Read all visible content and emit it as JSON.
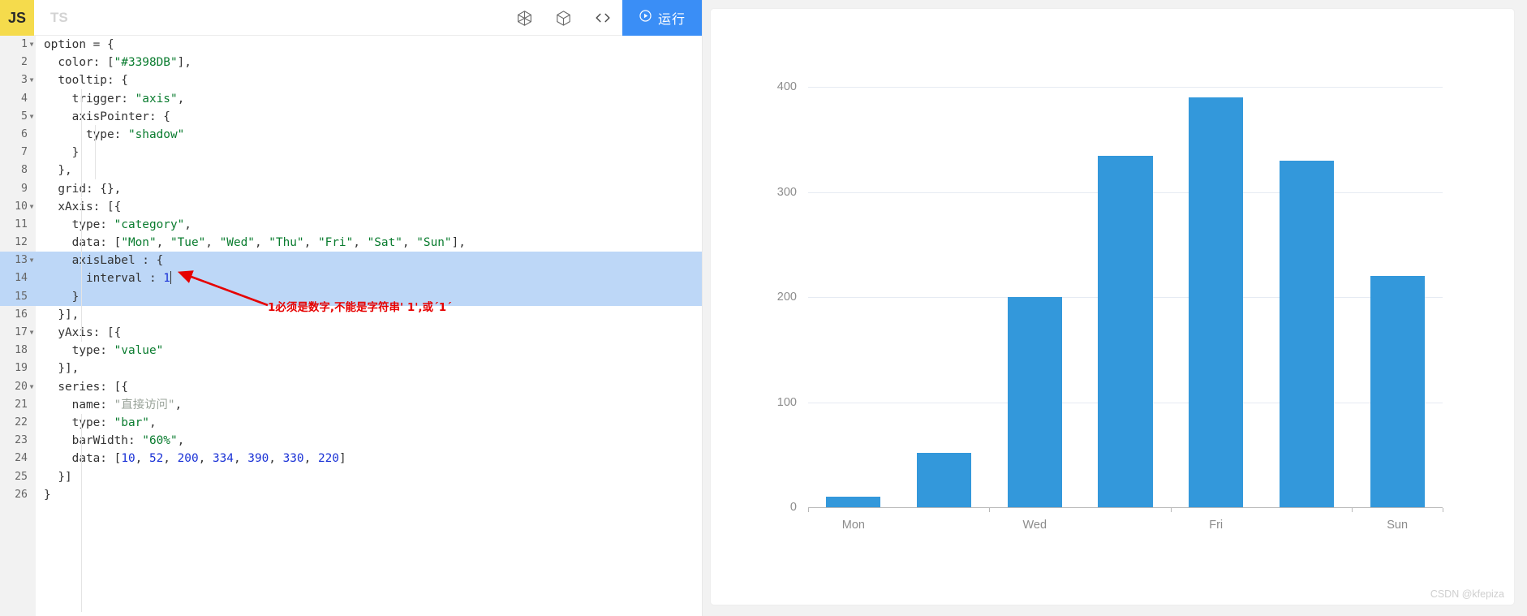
{
  "toolbar": {
    "tab_js": "JS",
    "tab_ts": "TS",
    "icon_gallery": "gallery-icon",
    "icon_cube": "cube-icon",
    "icon_code": "code-icon",
    "run_label": "运行",
    "run_icon": "play-circle-icon",
    "accent_color": "#3a8ef6",
    "js_tab_color": "#f5db4c"
  },
  "editor": {
    "total_lines": 26,
    "selected_lines": [
      13,
      14,
      15
    ],
    "lines": [
      {
        "n": 1,
        "fold": true,
        "tokens": [
          {
            "t": "plain",
            "v": "option = {"
          }
        ]
      },
      {
        "n": 2,
        "fold": false,
        "tokens": [
          {
            "t": "plain",
            "v": "  color: ["
          },
          {
            "t": "str",
            "v": "\"#3398DB\""
          },
          {
            "t": "plain",
            "v": "],"
          }
        ]
      },
      {
        "n": 3,
        "fold": true,
        "tokens": [
          {
            "t": "plain",
            "v": "  tooltip: {"
          }
        ]
      },
      {
        "n": 4,
        "fold": false,
        "tokens": [
          {
            "t": "plain",
            "v": "    trigger: "
          },
          {
            "t": "str",
            "v": "\"axis\""
          },
          {
            "t": "plain",
            "v": ","
          }
        ]
      },
      {
        "n": 5,
        "fold": true,
        "tokens": [
          {
            "t": "plain",
            "v": "    axisPointer: {"
          }
        ]
      },
      {
        "n": 6,
        "fold": false,
        "tokens": [
          {
            "t": "plain",
            "v": "      type: "
          },
          {
            "t": "str",
            "v": "\"shadow\""
          }
        ]
      },
      {
        "n": 7,
        "fold": false,
        "tokens": [
          {
            "t": "plain",
            "v": "    }"
          }
        ]
      },
      {
        "n": 8,
        "fold": false,
        "tokens": [
          {
            "t": "plain",
            "v": "  },"
          }
        ]
      },
      {
        "n": 9,
        "fold": false,
        "tokens": [
          {
            "t": "plain",
            "v": "  grid: {},"
          }
        ]
      },
      {
        "n": 10,
        "fold": true,
        "tokens": [
          {
            "t": "plain",
            "v": "  xAxis: [{"
          }
        ]
      },
      {
        "n": 11,
        "fold": false,
        "tokens": [
          {
            "t": "plain",
            "v": "    type: "
          },
          {
            "t": "str",
            "v": "\"category\""
          },
          {
            "t": "plain",
            "v": ","
          }
        ]
      },
      {
        "n": 12,
        "fold": false,
        "tokens": [
          {
            "t": "plain",
            "v": "    data: ["
          },
          {
            "t": "str",
            "v": "\"Mon\""
          },
          {
            "t": "plain",
            "v": ", "
          },
          {
            "t": "str",
            "v": "\"Tue\""
          },
          {
            "t": "plain",
            "v": ", "
          },
          {
            "t": "str",
            "v": "\"Wed\""
          },
          {
            "t": "plain",
            "v": ", "
          },
          {
            "t": "str",
            "v": "\"Thu\""
          },
          {
            "t": "plain",
            "v": ", "
          },
          {
            "t": "str",
            "v": "\"Fri\""
          },
          {
            "t": "plain",
            "v": ", "
          },
          {
            "t": "str",
            "v": "\"Sat\""
          },
          {
            "t": "plain",
            "v": ", "
          },
          {
            "t": "str",
            "v": "\"Sun\""
          },
          {
            "t": "plain",
            "v": "],"
          }
        ]
      },
      {
        "n": 13,
        "fold": true,
        "sel": true,
        "tokens": [
          {
            "t": "plain",
            "v": "    axisLabel : {"
          }
        ]
      },
      {
        "n": 14,
        "fold": false,
        "sel": true,
        "tokens": [
          {
            "t": "plain",
            "v": "      interval : "
          },
          {
            "t": "num",
            "v": "1"
          }
        ]
      },
      {
        "n": 15,
        "fold": false,
        "sel": true,
        "tokens": [
          {
            "t": "plain",
            "v": "    }"
          }
        ]
      },
      {
        "n": 16,
        "fold": false,
        "tokens": [
          {
            "t": "plain",
            "v": "  }],"
          }
        ]
      },
      {
        "n": 17,
        "fold": true,
        "tokens": [
          {
            "t": "plain",
            "v": "  yAxis: [{"
          }
        ]
      },
      {
        "n": 18,
        "fold": false,
        "tokens": [
          {
            "t": "plain",
            "v": "    type: "
          },
          {
            "t": "str",
            "v": "\"value\""
          }
        ]
      },
      {
        "n": 19,
        "fold": false,
        "tokens": [
          {
            "t": "plain",
            "v": "  }],"
          }
        ]
      },
      {
        "n": 20,
        "fold": true,
        "tokens": [
          {
            "t": "plain",
            "v": "  series: [{"
          }
        ]
      },
      {
        "n": 21,
        "fold": false,
        "tokens": [
          {
            "t": "plain",
            "v": "    name: "
          },
          {
            "t": "strg",
            "v": "\"直接访问\""
          },
          {
            "t": "plain",
            "v": ","
          }
        ]
      },
      {
        "n": 22,
        "fold": false,
        "tokens": [
          {
            "t": "plain",
            "v": "    type: "
          },
          {
            "t": "str",
            "v": "\"bar\""
          },
          {
            "t": "plain",
            "v": ","
          }
        ]
      },
      {
        "n": 23,
        "fold": false,
        "tokens": [
          {
            "t": "plain",
            "v": "    barWidth: "
          },
          {
            "t": "str",
            "v": "\"60%\""
          },
          {
            "t": "plain",
            "v": ","
          }
        ]
      },
      {
        "n": 24,
        "fold": false,
        "tokens": [
          {
            "t": "plain",
            "v": "    data: ["
          },
          {
            "t": "num",
            "v": "10"
          },
          {
            "t": "plain",
            "v": ", "
          },
          {
            "t": "num",
            "v": "52"
          },
          {
            "t": "plain",
            "v": ", "
          },
          {
            "t": "num",
            "v": "200"
          },
          {
            "t": "plain",
            "v": ", "
          },
          {
            "t": "num",
            "v": "334"
          },
          {
            "t": "plain",
            "v": ", "
          },
          {
            "t": "num",
            "v": "390"
          },
          {
            "t": "plain",
            "v": ", "
          },
          {
            "t": "num",
            "v": "330"
          },
          {
            "t": "plain",
            "v": ", "
          },
          {
            "t": "num",
            "v": "220"
          },
          {
            "t": "plain",
            "v": "]"
          }
        ]
      },
      {
        "n": 25,
        "fold": false,
        "tokens": [
          {
            "t": "plain",
            "v": "  }]"
          }
        ]
      },
      {
        "n": 26,
        "fold": false,
        "tokens": [
          {
            "t": "plain",
            "v": "}"
          }
        ]
      }
    ]
  },
  "annotation": {
    "text": "1必须是数字,不能是字符串' 1',或´1´",
    "color": "#e60000",
    "arrow": "red-arrow-pointing-to-interval-value"
  },
  "chart_data": {
    "type": "bar",
    "title": "",
    "xlabel": "",
    "ylabel": "",
    "categories": [
      "Mon",
      "Tue",
      "Wed",
      "Thu",
      "Fri",
      "Sat",
      "Sun"
    ],
    "visible_tick_labels": [
      "Mon",
      "Wed",
      "Fri",
      "Sun"
    ],
    "values": [
      10,
      52,
      200,
      334,
      390,
      330,
      220
    ],
    "series": [
      {
        "name": "直接访问",
        "values": [
          10,
          52,
          200,
          334,
          390,
          330,
          220
        ]
      }
    ],
    "ylim": [
      0,
      400
    ],
    "y_ticks": [
      0,
      100,
      200,
      300,
      400
    ],
    "bar_color": "#3398DB",
    "bar_width_pct": "60%",
    "grid": true,
    "legend": "none",
    "axis_label_interval": 1
  },
  "watermark": "CSDN @kfepiza"
}
